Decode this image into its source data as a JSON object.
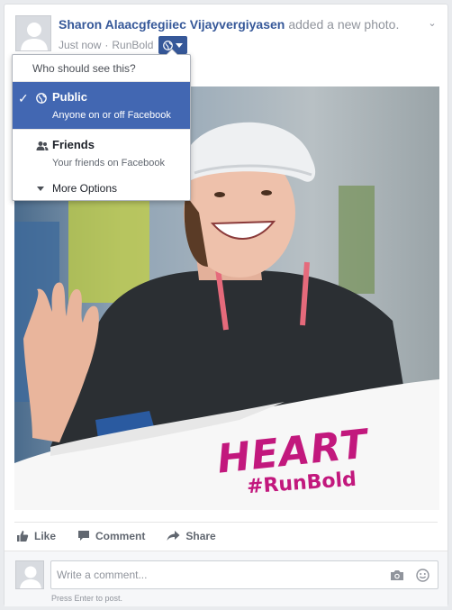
{
  "post": {
    "author": "Sharon Alaacgfegiiec Vijayvergiyasen",
    "action_text": "added a new photo.",
    "timestamp": "Just now",
    "separator": "·",
    "app": "RunBold",
    "audience_icon": "globe-icon",
    "menu_icon": "chevron-down-icon"
  },
  "audience_menu": {
    "title": "Who should see this?",
    "options": [
      {
        "label": "Public",
        "sublabel": "Anyone on or off Facebook",
        "icon": "globe-icon",
        "selected": true
      },
      {
        "label": "Friends",
        "sublabel": "Your friends on Facebook",
        "icon": "friends-icon",
        "selected": false
      }
    ],
    "more_label": "More Options"
  },
  "photo": {
    "overlay_title": "HEART",
    "overlay_tag": "#RunBold",
    "overlay_color": "#c2187d"
  },
  "actions": {
    "like": "Like",
    "comment": "Comment",
    "share": "Share"
  },
  "comment_composer": {
    "placeholder": "Write a comment...",
    "hint": "Press Enter to post.",
    "camera_icon": "camera-icon",
    "emoji_icon": "emoji-icon"
  },
  "colors": {
    "link": "#365899",
    "accent": "#4267b2",
    "muted": "#90949c"
  }
}
